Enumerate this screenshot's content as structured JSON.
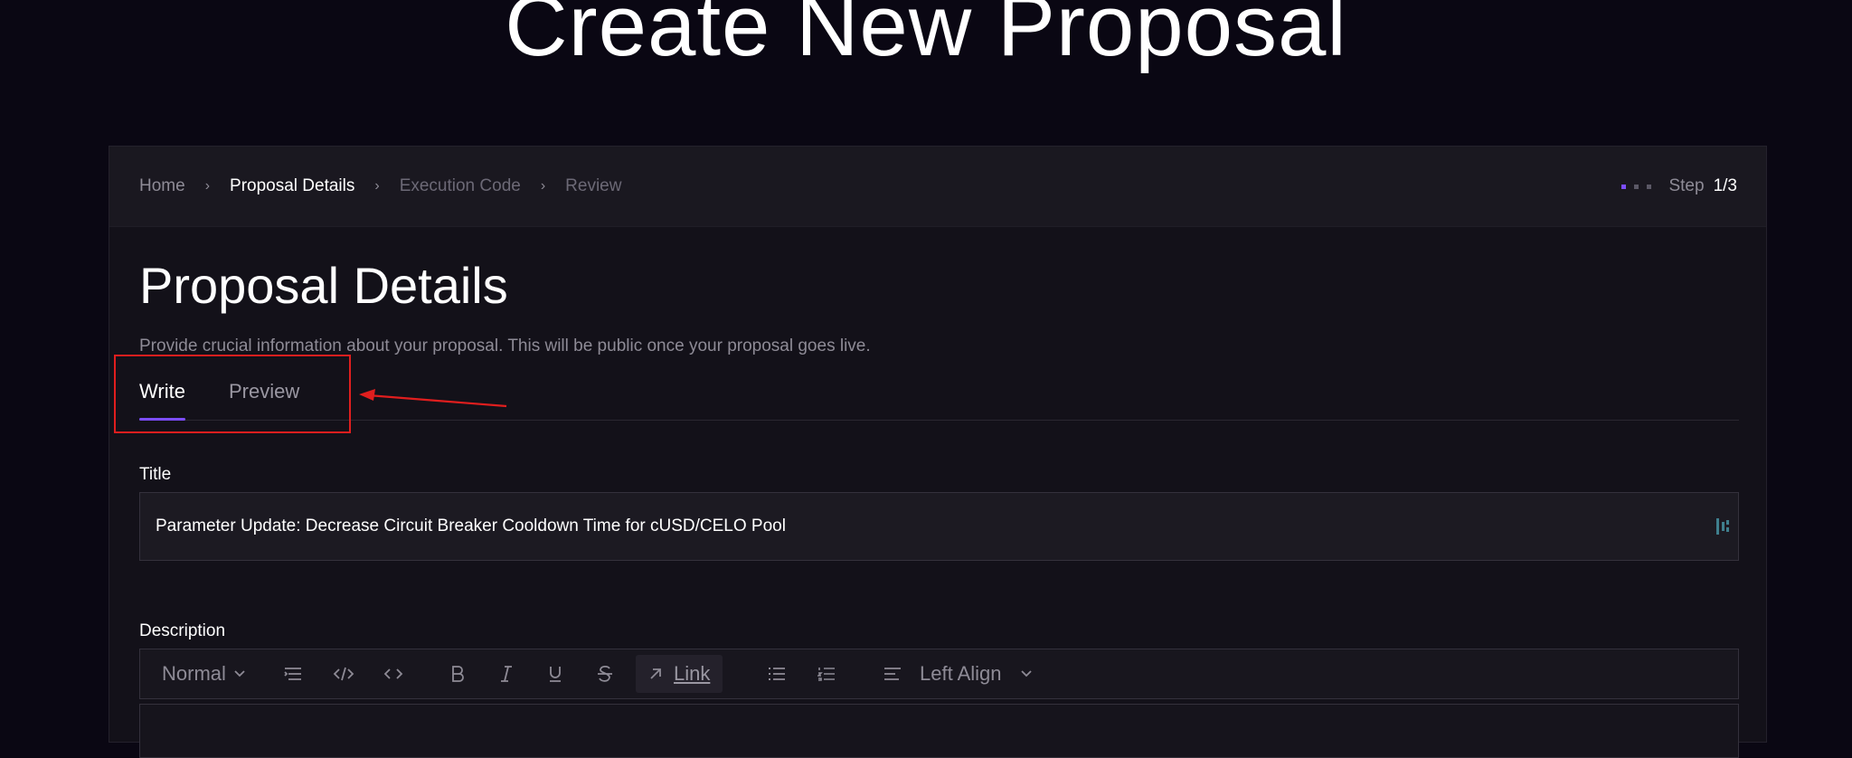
{
  "page": {
    "heading": "Create New Proposal"
  },
  "breadcrumb": {
    "items": [
      {
        "label": "Home",
        "state": "default"
      },
      {
        "label": "Proposal Details",
        "state": "active"
      },
      {
        "label": "Execution Code",
        "state": "muted"
      },
      {
        "label": "Review",
        "state": "muted"
      }
    ],
    "separator_icon": "chevron-right-icon"
  },
  "stepper": {
    "label": "Step",
    "count": "1/3",
    "current": 1,
    "total": 3
  },
  "section": {
    "title": "Proposal Details",
    "subtitle": "Provide crucial information about your proposal. This will be public once your proposal goes live."
  },
  "tabs": [
    {
      "label": "Write",
      "active": true
    },
    {
      "label": "Preview",
      "active": false
    }
  ],
  "form": {
    "title_label": "Title",
    "title_value": "Parameter Update: Decrease Circuit Breaker Cooldown Time for cUSD/CELO Pool",
    "description_label": "Description"
  },
  "toolbar": {
    "text_style": "Normal",
    "link_label": "Link",
    "align_label": "Left Align",
    "icons": [
      "chevron-down-icon",
      "indent-icon",
      "code-inline-icon",
      "code-block-icon",
      "bold-icon",
      "italic-icon",
      "underline-icon",
      "strikethrough-icon",
      "link-icon",
      "bullet-list-icon",
      "numbered-list-icon",
      "align-left-icon"
    ]
  },
  "colors": {
    "background": "#0a0713",
    "accent": "#7c4dff",
    "annotation": "#e01e1e"
  }
}
